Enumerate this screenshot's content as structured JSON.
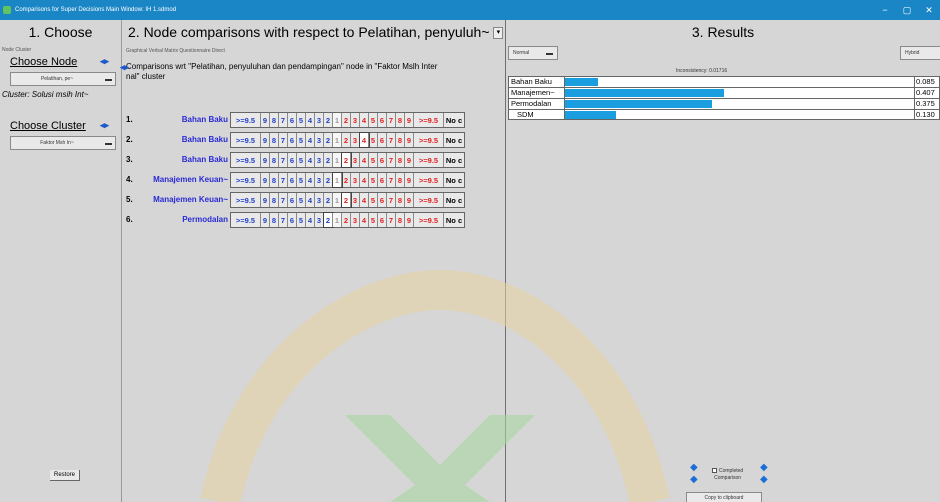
{
  "window": {
    "title": "Comparisons for Super Decisions Main Window: IH 1.sdmod",
    "controls": [
      "−",
      "▢",
      "✕"
    ]
  },
  "panel1": {
    "heading": "1. Choose",
    "tabs": "Node  Cluster",
    "choose_node_label": "Choose Node",
    "node_combo": "Pelatihan, pe~",
    "cluster_text": "Cluster: Solusi msih Int~",
    "choose_cluster_label": "Choose Cluster",
    "cluster_combo": "Faktor Msh In~",
    "restore": "Restore"
  },
  "panel2": {
    "heading": "2. Node comparisons with respect to Pelatihan,  penyuluh~",
    "tabs": "Graphical  Verbal  Matrix  Questionnaire  Direct",
    "comparison_text_1": "Comparisons wrt \"Pelatihan,  penyuluhan dan pendampingan\" node in \"Faktor Mslh Inter",
    "comparison_text_2": "nal\" cluster",
    "left_scale": [
      ">=9.5",
      "9",
      "8",
      "7",
      "6",
      "5",
      "4",
      "3",
      "2"
    ],
    "one": "1",
    "right_scale": [
      "2",
      "3",
      "4",
      "5",
      "6",
      "7",
      "8",
      "9",
      ">=9.5"
    ],
    "noc": "No c",
    "rows": [
      {
        "num": "1.",
        "name": "Bahan Baku"
      },
      {
        "num": "2.",
        "name": "Bahan Baku"
      },
      {
        "num": "3.",
        "name": "Bahan Baku"
      },
      {
        "num": "4.",
        "name": "Manajemen Keuan~"
      },
      {
        "num": "5.",
        "name": "Manajemen Keuan~"
      },
      {
        "num": "6.",
        "name": "Permodalan"
      }
    ]
  },
  "panel3": {
    "heading": "3. Results",
    "mode_combo": "Normal",
    "hybrid_combo": "Hybrid",
    "inconsistency": "Inconsistency: 0.01716",
    "results": [
      {
        "name": "Bahan Baku",
        "value": "0.085",
        "fraction": 0.085
      },
      {
        "name": "Manajemen~",
        "value": "0.407",
        "fraction": 0.407
      },
      {
        "name": "Permodalan",
        "value": "0.375",
        "fraction": 0.375
      },
      {
        "name": "SDM",
        "value": "0.130",
        "fraction": 0.13
      }
    ],
    "completed_label_1": "Completed",
    "completed_label_2": "Comparison",
    "copy_button": "Copy to clipboard"
  },
  "colors": {
    "titlebar": "#1b86c6",
    "bar_fill": "#1a9ee0",
    "left_scale": "#1e3fc8",
    "right_scale": "#e02020",
    "row_name": "#2a2ad6"
  }
}
